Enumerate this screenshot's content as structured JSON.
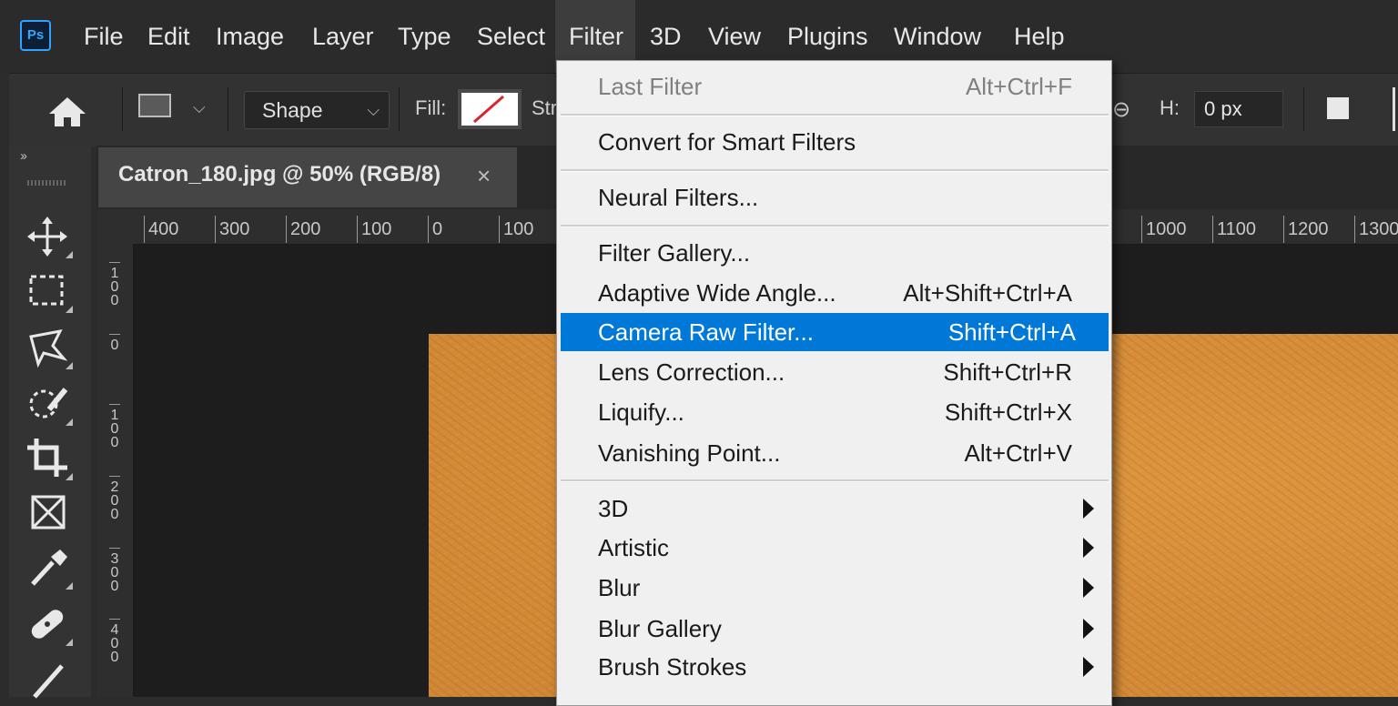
{
  "app": {
    "logo_text": "Ps"
  },
  "menubar": {
    "items": [
      {
        "label": "File"
      },
      {
        "label": "Edit"
      },
      {
        "label": "Image"
      },
      {
        "label": "Layer"
      },
      {
        "label": "Type"
      },
      {
        "label": "Select"
      },
      {
        "label": "Filter"
      },
      {
        "label": "3D"
      },
      {
        "label": "View"
      },
      {
        "label": "Plugins"
      },
      {
        "label": "Window"
      },
      {
        "label": "Help"
      }
    ],
    "active": "Filter"
  },
  "options": {
    "mode_select": "Shape",
    "fill_label": "Fill:",
    "stroke_label_partial": "Str",
    "h_label": "H:",
    "h_value": "0 px"
  },
  "document_tab": {
    "title": "Catron_180.jpg @ 50% (RGB/8)",
    "close": "×"
  },
  "toolbar": {
    "collapse": "››"
  },
  "rulers": {
    "horizontal": [
      "400",
      "300",
      "200",
      "100",
      "0",
      "100",
      "1000",
      "1100",
      "1200",
      "1300"
    ],
    "vertical": [
      "1\n0\n0",
      "0",
      "1\n0\n0",
      "2\n0\n0",
      "3\n0\n0",
      "4\n0\n0"
    ]
  },
  "filter_menu": {
    "last_filter": {
      "label": "Last Filter",
      "shortcut": "Alt+Ctrl+F"
    },
    "convert_smart": {
      "label": "Convert for Smart Filters"
    },
    "neural": {
      "label": "Neural Filters..."
    },
    "filter_gallery": {
      "label": "Filter Gallery..."
    },
    "adaptive": {
      "label": "Adaptive Wide Angle...",
      "shortcut": "Alt+Shift+Ctrl+A"
    },
    "camera_raw": {
      "label": "Camera Raw Filter...",
      "shortcut": "Shift+Ctrl+A"
    },
    "lens": {
      "label": "Lens Correction...",
      "shortcut": "Shift+Ctrl+R"
    },
    "liquify": {
      "label": "Liquify...",
      "shortcut": "Shift+Ctrl+X"
    },
    "vanishing": {
      "label": "Vanishing Point...",
      "shortcut": "Alt+Ctrl+V"
    },
    "submenus": [
      {
        "label": "3D"
      },
      {
        "label": "Artistic"
      },
      {
        "label": "Blur"
      },
      {
        "label": "Blur Gallery"
      },
      {
        "label": "Brush Strokes"
      }
    ]
  },
  "colors": {
    "highlight": "#0078d7",
    "canvas_image": "#d78e3a",
    "logo_accent": "#31a8ff"
  }
}
